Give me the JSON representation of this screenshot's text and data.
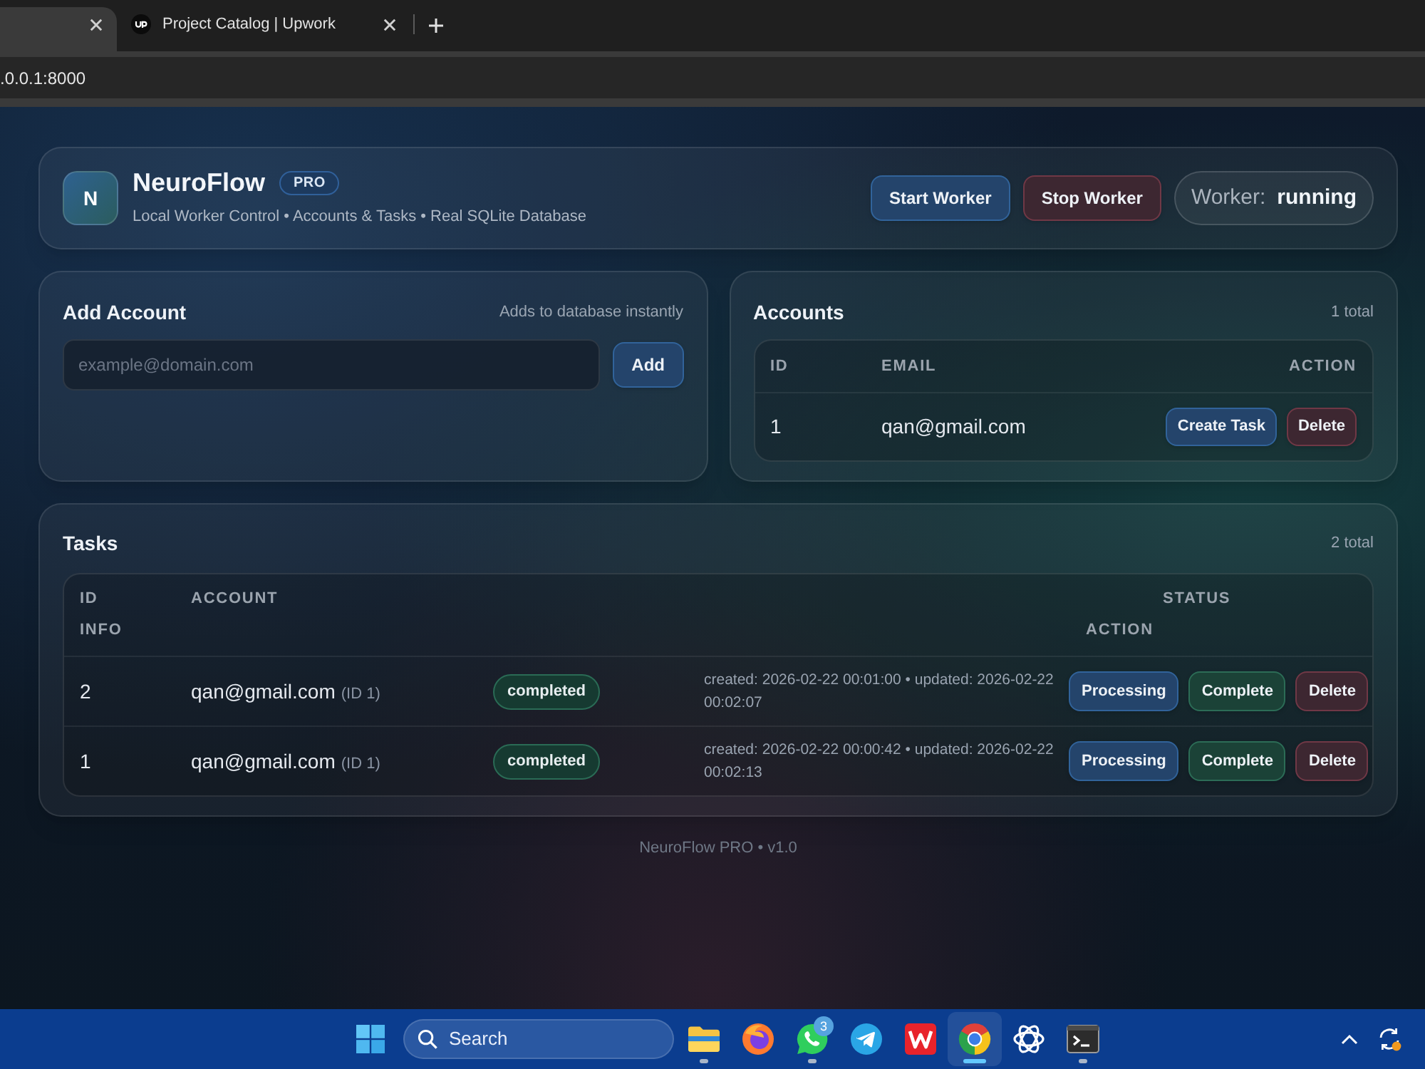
{
  "browser": {
    "tabs": [
      {
        "selected": true
      },
      {
        "title": "Project Catalog | Upwork",
        "selected": false
      }
    ],
    "address": ".0.0.1:8000"
  },
  "header": {
    "logo": "N",
    "title": "NeuroFlow",
    "badge": "PRO",
    "subtitle": "Local Worker Control • Accounts & Tasks • Real SQLite Database",
    "buttons": [
      {
        "label": "Start Worker",
        "kind": "primary"
      },
      {
        "label": "Stop Worker",
        "kind": "danger"
      }
    ],
    "worker_status": {
      "label": "Worker:",
      "value": "running"
    }
  },
  "add_account": {
    "title": "Add Account",
    "hint": "Adds to database instantly",
    "input": {
      "placeholder": "example@domain.com"
    },
    "button": {
      "label": "Add",
      "kind": "primary"
    }
  },
  "accounts": {
    "title": "Accounts",
    "count": "1 total",
    "columns": [
      "ID",
      "EMAIL",
      "ACTION"
    ],
    "rows": [
      {
        "id": "1",
        "email": "qan@gmail.com",
        "actions": [
          {
            "label": "Create Task",
            "kind": "primary"
          },
          {
            "label": "Delete",
            "kind": "danger"
          }
        ]
      }
    ]
  },
  "tasks": {
    "title": "Tasks",
    "count": "2 total",
    "columns": [
      "ID",
      "ACCOUNT",
      "STATUS",
      "INFO",
      "ACTION"
    ],
    "rows": [
      {
        "id": "2",
        "account": "qan@gmail.com",
        "account_ref": "(ID 1)",
        "status": "completed",
        "info": "created: 2026-02-22 00:01:00 • updated: 2026-02-22 00:02:07",
        "actions": [
          {
            "label": "Processing",
            "kind": "primary"
          },
          {
            "label": "Complete",
            "kind": "success"
          },
          {
            "label": "Delete",
            "kind": "danger"
          }
        ]
      },
      {
        "id": "1",
        "account": "qan@gmail.com",
        "account_ref": "(ID 1)",
        "status": "completed",
        "info": "created: 2026-02-22 00:00:42 • updated: 2026-02-22 00:02:13",
        "actions": [
          {
            "label": "Processing",
            "kind": "primary"
          },
          {
            "label": "Complete",
            "kind": "success"
          },
          {
            "label": "Delete",
            "kind": "danger"
          }
        ]
      }
    ]
  },
  "footer": "NeuroFlow PRO • v1.0",
  "taskbar": {
    "search": {
      "label": "Search"
    },
    "apps": [
      {
        "kind": "folder",
        "running": true,
        "selected": false
      },
      {
        "kind": "firefox",
        "running": false,
        "selected": false
      },
      {
        "kind": "whatsapp",
        "running": true,
        "selected": false,
        "badge": "3"
      },
      {
        "kind": "telegram",
        "running": false,
        "selected": false
      },
      {
        "kind": "wps",
        "running": false,
        "selected": false
      },
      {
        "kind": "chrome",
        "running": true,
        "selected": true
      },
      {
        "kind": "chatgpt",
        "running": false,
        "selected": false
      },
      {
        "kind": "terminal",
        "running": true,
        "selected": false
      }
    ]
  }
}
